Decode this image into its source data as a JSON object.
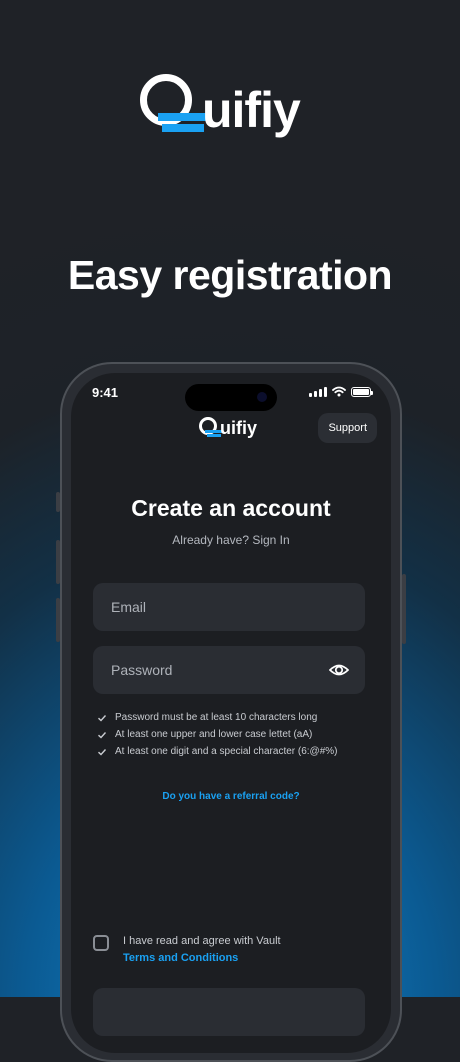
{
  "brand": {
    "name": "uifiy"
  },
  "headline": "Easy registration",
  "status_bar": {
    "time": "9:41"
  },
  "app": {
    "support_label": "Support",
    "title": "Create an account",
    "signin_prompt": "Already have? Sign In",
    "email": {
      "placeholder": "Email",
      "value": ""
    },
    "password": {
      "placeholder": "Password",
      "value": ""
    },
    "rules": [
      "Password must be at least 10 characters long",
      "At least one upper and lower case lettet (aA)",
      "At least one digit and a special character (6:@#%)"
    ],
    "referral_link": "Do you have a referral code?",
    "agreement": {
      "text": "I have read and agree with Vault",
      "link": "Terms and Conditions"
    }
  },
  "colors": {
    "accent": "#1aa1f2",
    "surface": "#1c1e22",
    "field": "#2a2d33"
  }
}
